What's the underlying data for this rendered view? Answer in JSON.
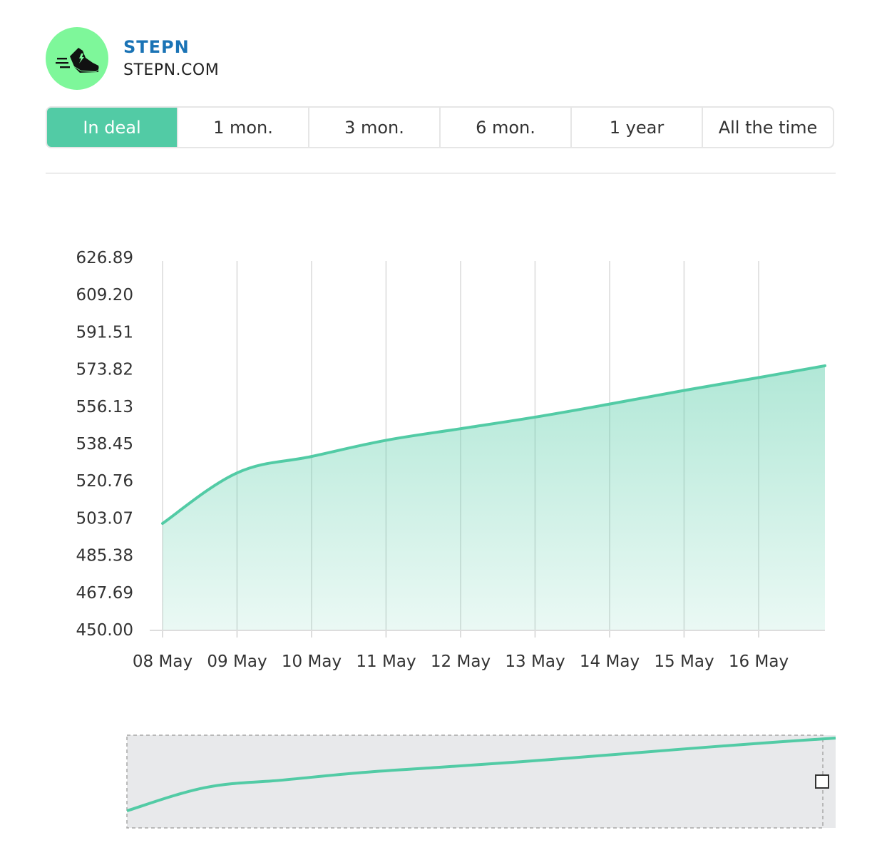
{
  "brand": {
    "name": "STEPN",
    "site": "STEPN.COM",
    "logo_icon": "running-shoe-icon",
    "logo_bg": "#7ef79a",
    "name_color": "#1a73b5"
  },
  "tabs": [
    {
      "label": "In deal",
      "active": true
    },
    {
      "label": "1 mon.",
      "active": false
    },
    {
      "label": "3 mon.",
      "active": false
    },
    {
      "label": "6 mon.",
      "active": false
    },
    {
      "label": "1 year",
      "active": false
    },
    {
      "label": "All the time",
      "active": false
    }
  ],
  "colors": {
    "accent": "#52cba5",
    "grid": "#e3e3e3",
    "navigator_bg": "#e8e9eb"
  },
  "chart_data": {
    "type": "area",
    "x": [
      "08 May",
      "09 May",
      "10 May",
      "11 May",
      "12 May",
      "13 May",
      "14 May",
      "15 May",
      "16 May",
      "17 May"
    ],
    "y": [
      500.5,
      524.5,
      532.3,
      540.0,
      545.5,
      551.0,
      557.2,
      563.7,
      569.8,
      575.4
    ],
    "xtick_labels": [
      "08 May",
      "09 May",
      "10 May",
      "11 May",
      "12 May",
      "13 May",
      "14 May",
      "15 May",
      "16 May"
    ],
    "yticks": [
      "626.89",
      "609.20",
      "591.51",
      "573.82",
      "556.13",
      "538.45",
      "520.76",
      "503.07",
      "485.38",
      "467.69",
      "450.00"
    ],
    "ylim": [
      450.0,
      626.89
    ],
    "grid": "vertical",
    "navigator": true
  }
}
